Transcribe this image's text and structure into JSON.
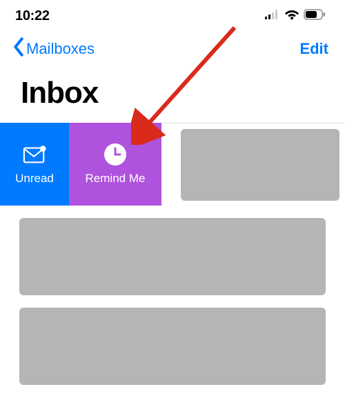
{
  "status": {
    "time": "10:22"
  },
  "nav": {
    "back_label": "Mailboxes",
    "edit_label": "Edit"
  },
  "title": "Inbox",
  "swipe": {
    "unread_label": "Unread",
    "remind_label": "Remind Me"
  },
  "annotation": {
    "color": "#d92a1c"
  }
}
